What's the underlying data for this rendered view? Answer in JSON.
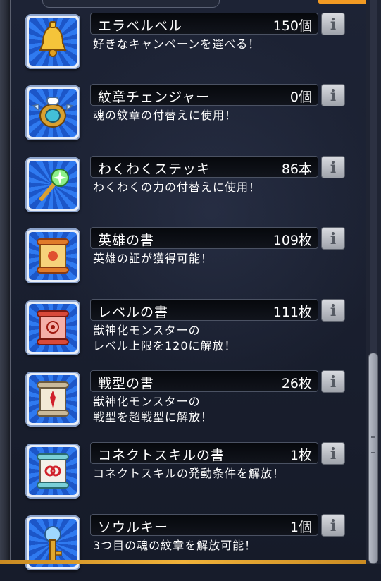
{
  "items": [
    {
      "name": "エラベルベル",
      "count": "150個",
      "desc_lines": [
        "好きなキャンペーンを選べる！"
      ],
      "icon": "bell-icon"
    },
    {
      "name": "紋章チェンジャー",
      "count": "0個",
      "desc_lines": [
        "魂の紋章の付替えに使用！"
      ],
      "icon": "crest-changer-icon"
    },
    {
      "name": "わくわくステッキ",
      "count": "86本",
      "desc_lines": [
        "わくわくの力の付替えに使用！"
      ],
      "icon": "wand-icon"
    },
    {
      "name": "英雄の書",
      "count": "109枚",
      "desc_lines": [
        "英雄の証が獲得可能！"
      ],
      "icon": "hero-scroll-icon"
    },
    {
      "name": "レベルの書",
      "count": "111枚",
      "desc_lines": [
        "獣神化モンスターの",
        "レベル上限を120に解放！"
      ],
      "icon": "level-scroll-icon"
    },
    {
      "name": "戦型の書",
      "count": "26枚",
      "desc_lines": [
        "獣神化モンスターの",
        "戦型を超戦型に解放！"
      ],
      "icon": "battle-type-scroll-icon"
    },
    {
      "name": "コネクトスキルの書",
      "count": "1枚",
      "desc_lines": [
        "コネクトスキルの発動条件を解放！"
      ],
      "icon": "connect-skill-scroll-icon"
    },
    {
      "name": "ソウルキー",
      "count": "1個",
      "desc_lines": [
        "3つ目の魂の紋章を解放可能！"
      ],
      "icon": "soul-key-icon"
    }
  ],
  "info_button_glyph": "i",
  "colors": {
    "icon_blue": "#2f7af0",
    "accent_orange": "#f29a23"
  }
}
